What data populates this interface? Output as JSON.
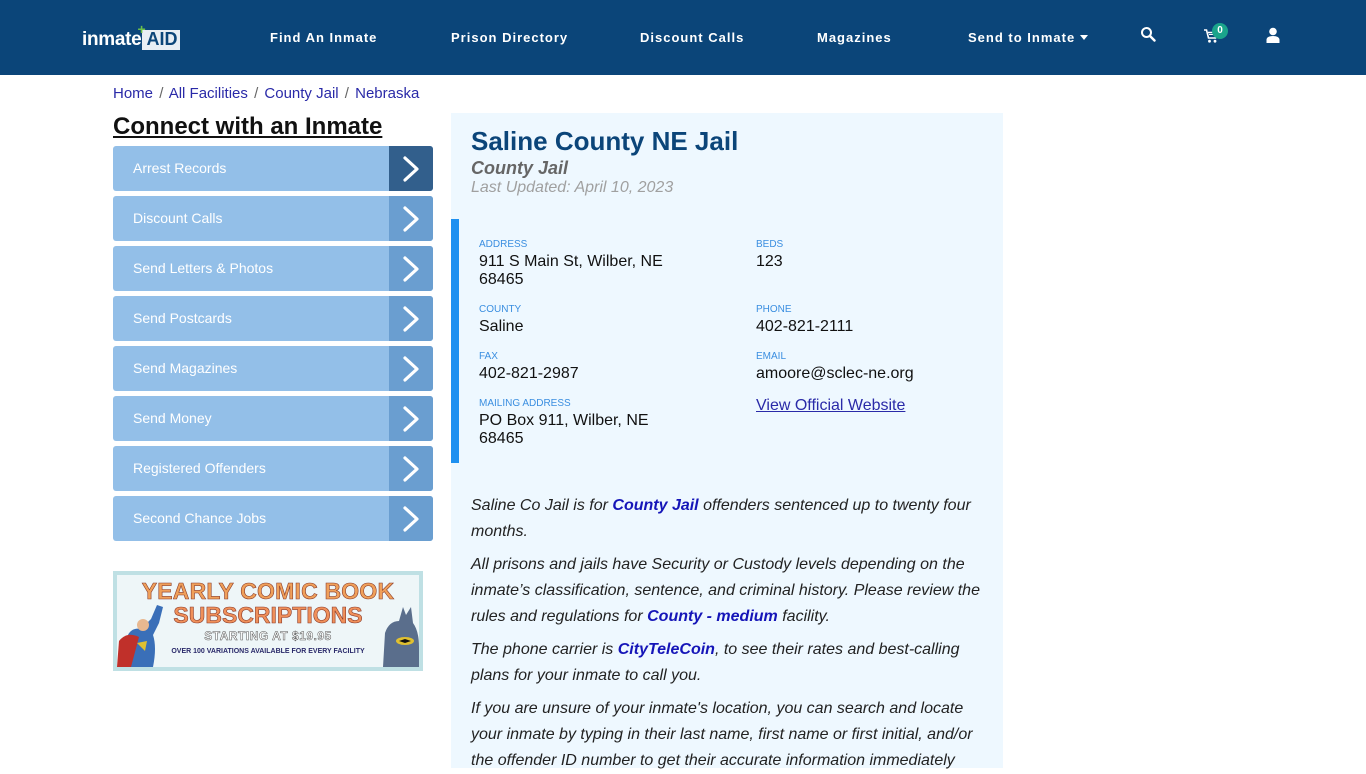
{
  "header": {
    "logo_text": "inmate",
    "logo_accent": "AID",
    "logo_plus": "+",
    "nav": [
      {
        "label": "Find An Inmate"
      },
      {
        "label": "Prison Directory"
      },
      {
        "label": "Discount Calls"
      },
      {
        "label": "Magazines"
      },
      {
        "label": "Send to Inmate",
        "has_dropdown": true
      }
    ],
    "icons": [
      "search-icon",
      "cart-icon",
      "user-icon"
    ],
    "cart_count": "0",
    "colors": {
      "bar": "#0b4579",
      "badge": "#1aa48b"
    }
  },
  "breadcrumb": [
    {
      "label": "Home"
    },
    {
      "label": "All Facilities"
    },
    {
      "label": "County Jail"
    },
    {
      "label": "Nebraska"
    }
  ],
  "breadcrumb_separator": "/",
  "sidebar": {
    "title": "Connect with an Inmate",
    "items": [
      {
        "label": "Arrest Records",
        "active": true
      },
      {
        "label": "Discount Calls"
      },
      {
        "label": "Send Letters & Photos"
      },
      {
        "label": "Send Postcards"
      },
      {
        "label": "Send Magazines"
      },
      {
        "label": "Send Money"
      },
      {
        "label": "Registered Offenders"
      },
      {
        "label": "Second Chance Jobs"
      }
    ],
    "banner": {
      "line1": "YEARLY COMIC BOOK",
      "line2": "SUBSCRIPTIONS",
      "line3": "STARTING AT $19.95",
      "line4": "OVER 100 VARIATIONS AVAILABLE FOR EVERY FACILITY"
    }
  },
  "facility": {
    "name": "Saline County NE Jail",
    "type": "County Jail",
    "last_updated": "Last Updated: April 10, 2023",
    "fields": {
      "address": {
        "label": "Address",
        "value_line1": "911 S Main St, Wilber, NE",
        "value_line2": "68465"
      },
      "beds": {
        "label": "Beds",
        "value": "123"
      },
      "county": {
        "label": "County",
        "value": "Saline"
      },
      "phone": {
        "label": "Phone",
        "value": "402-821-2111"
      },
      "fax": {
        "label": "Fax",
        "value": "402-821-2987"
      },
      "email": {
        "label": "Email",
        "value": "amoore@sclec-ne.org"
      },
      "mailing": {
        "label": "Mailing Address",
        "value_line1": "PO Box 911, Wilber, NE",
        "value_line2": "68465"
      },
      "website_link": "View Official Website"
    },
    "paragraphs": {
      "p1": {
        "pre": "Saline Co Jail is for ",
        "link": "County Jail",
        "post": " offenders sentenced up to twenty four months."
      },
      "p2": {
        "pre": "All prisons and jails have Security or Custody levels depending on the inmate’s classification, sentence, and criminal history. Please review the rules and regulations for ",
        "link": "County - medium",
        "post": " facility."
      },
      "p3": {
        "pre": "The phone carrier is ",
        "link": "CityTeleCoin",
        "post": ", to see their rates and best-calling plans for your inmate to call you."
      },
      "p4": {
        "text": "If you are unsure of your inmate's location, you can search and locate your inmate by typing in their last name, first name or first initial, and/or the offender ID number to get their accurate information immediately"
      }
    }
  }
}
